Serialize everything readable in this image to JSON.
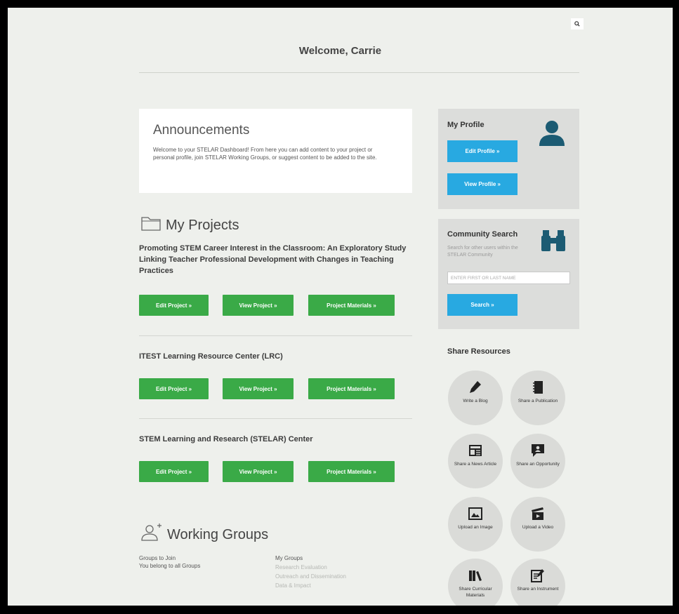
{
  "header": {
    "welcome": "Welcome, Carrie",
    "search_icon": "search-icon"
  },
  "announcements": {
    "title": "Announcements",
    "body": "Welcome to your STELAR Dashboard! From here you can add content to your project or personal profile, join STELAR Working Groups, or suggest content to be added to the site."
  },
  "projects": {
    "title": "My Projects",
    "items": [
      {
        "name": "Promoting STEM Career Interest in the Classroom: An Exploratory Study Linking Teacher Professional Development with Changes in Teaching Practices",
        "edit": "Edit Project »",
        "view": "View Project »",
        "materials": "Project Materials »"
      },
      {
        "name": "ITEST Learning Resource Center (LRC)",
        "edit": "Edit Project »",
        "view": "View Project »",
        "materials": "Project Materials »"
      },
      {
        "name": "STEM Learning and Research (STELAR) Center",
        "edit": "Edit Project »",
        "view": "View Project »",
        "materials": "Project Materials »"
      }
    ]
  },
  "working_groups": {
    "title": "Working Groups",
    "to_join_label": "Groups to Join",
    "to_join_text": "You belong to all Groups",
    "my_groups_label": "My Groups",
    "my_groups": [
      "Research Evaluation",
      "Outreach and Dissemination",
      "Data & Impact"
    ]
  },
  "profile": {
    "title": "My Profile",
    "edit": "Edit Profile »",
    "view": "View Profile »"
  },
  "community": {
    "title": "Community Search",
    "hint": "Search for other users within the STELAR Community",
    "placeholder": "ENTER FIRST OR LAST NAME",
    "search": "Search »"
  },
  "share": {
    "title": "Share Resources",
    "items": [
      {
        "label": "Write a Blog",
        "icon": "pencil-icon"
      },
      {
        "label": "Share a Publication",
        "icon": "notebook-icon"
      },
      {
        "label": "Share a News Article",
        "icon": "newspaper-icon"
      },
      {
        "label": "Share an Opportunity",
        "icon": "speech-bubble-icon"
      },
      {
        "label": "Upload an Image",
        "icon": "image-icon"
      },
      {
        "label": "Upload a Video",
        "icon": "video-clapper-icon"
      },
      {
        "label": "Share Curricular Materials",
        "icon": "books-icon"
      },
      {
        "label": "Share an Instrument",
        "icon": "instrument-edit-icon"
      }
    ]
  },
  "colors": {
    "green": "#3aaa47",
    "blue": "#28a9e1",
    "teal_icon": "#1c5b73",
    "background": "#eef0ec"
  }
}
